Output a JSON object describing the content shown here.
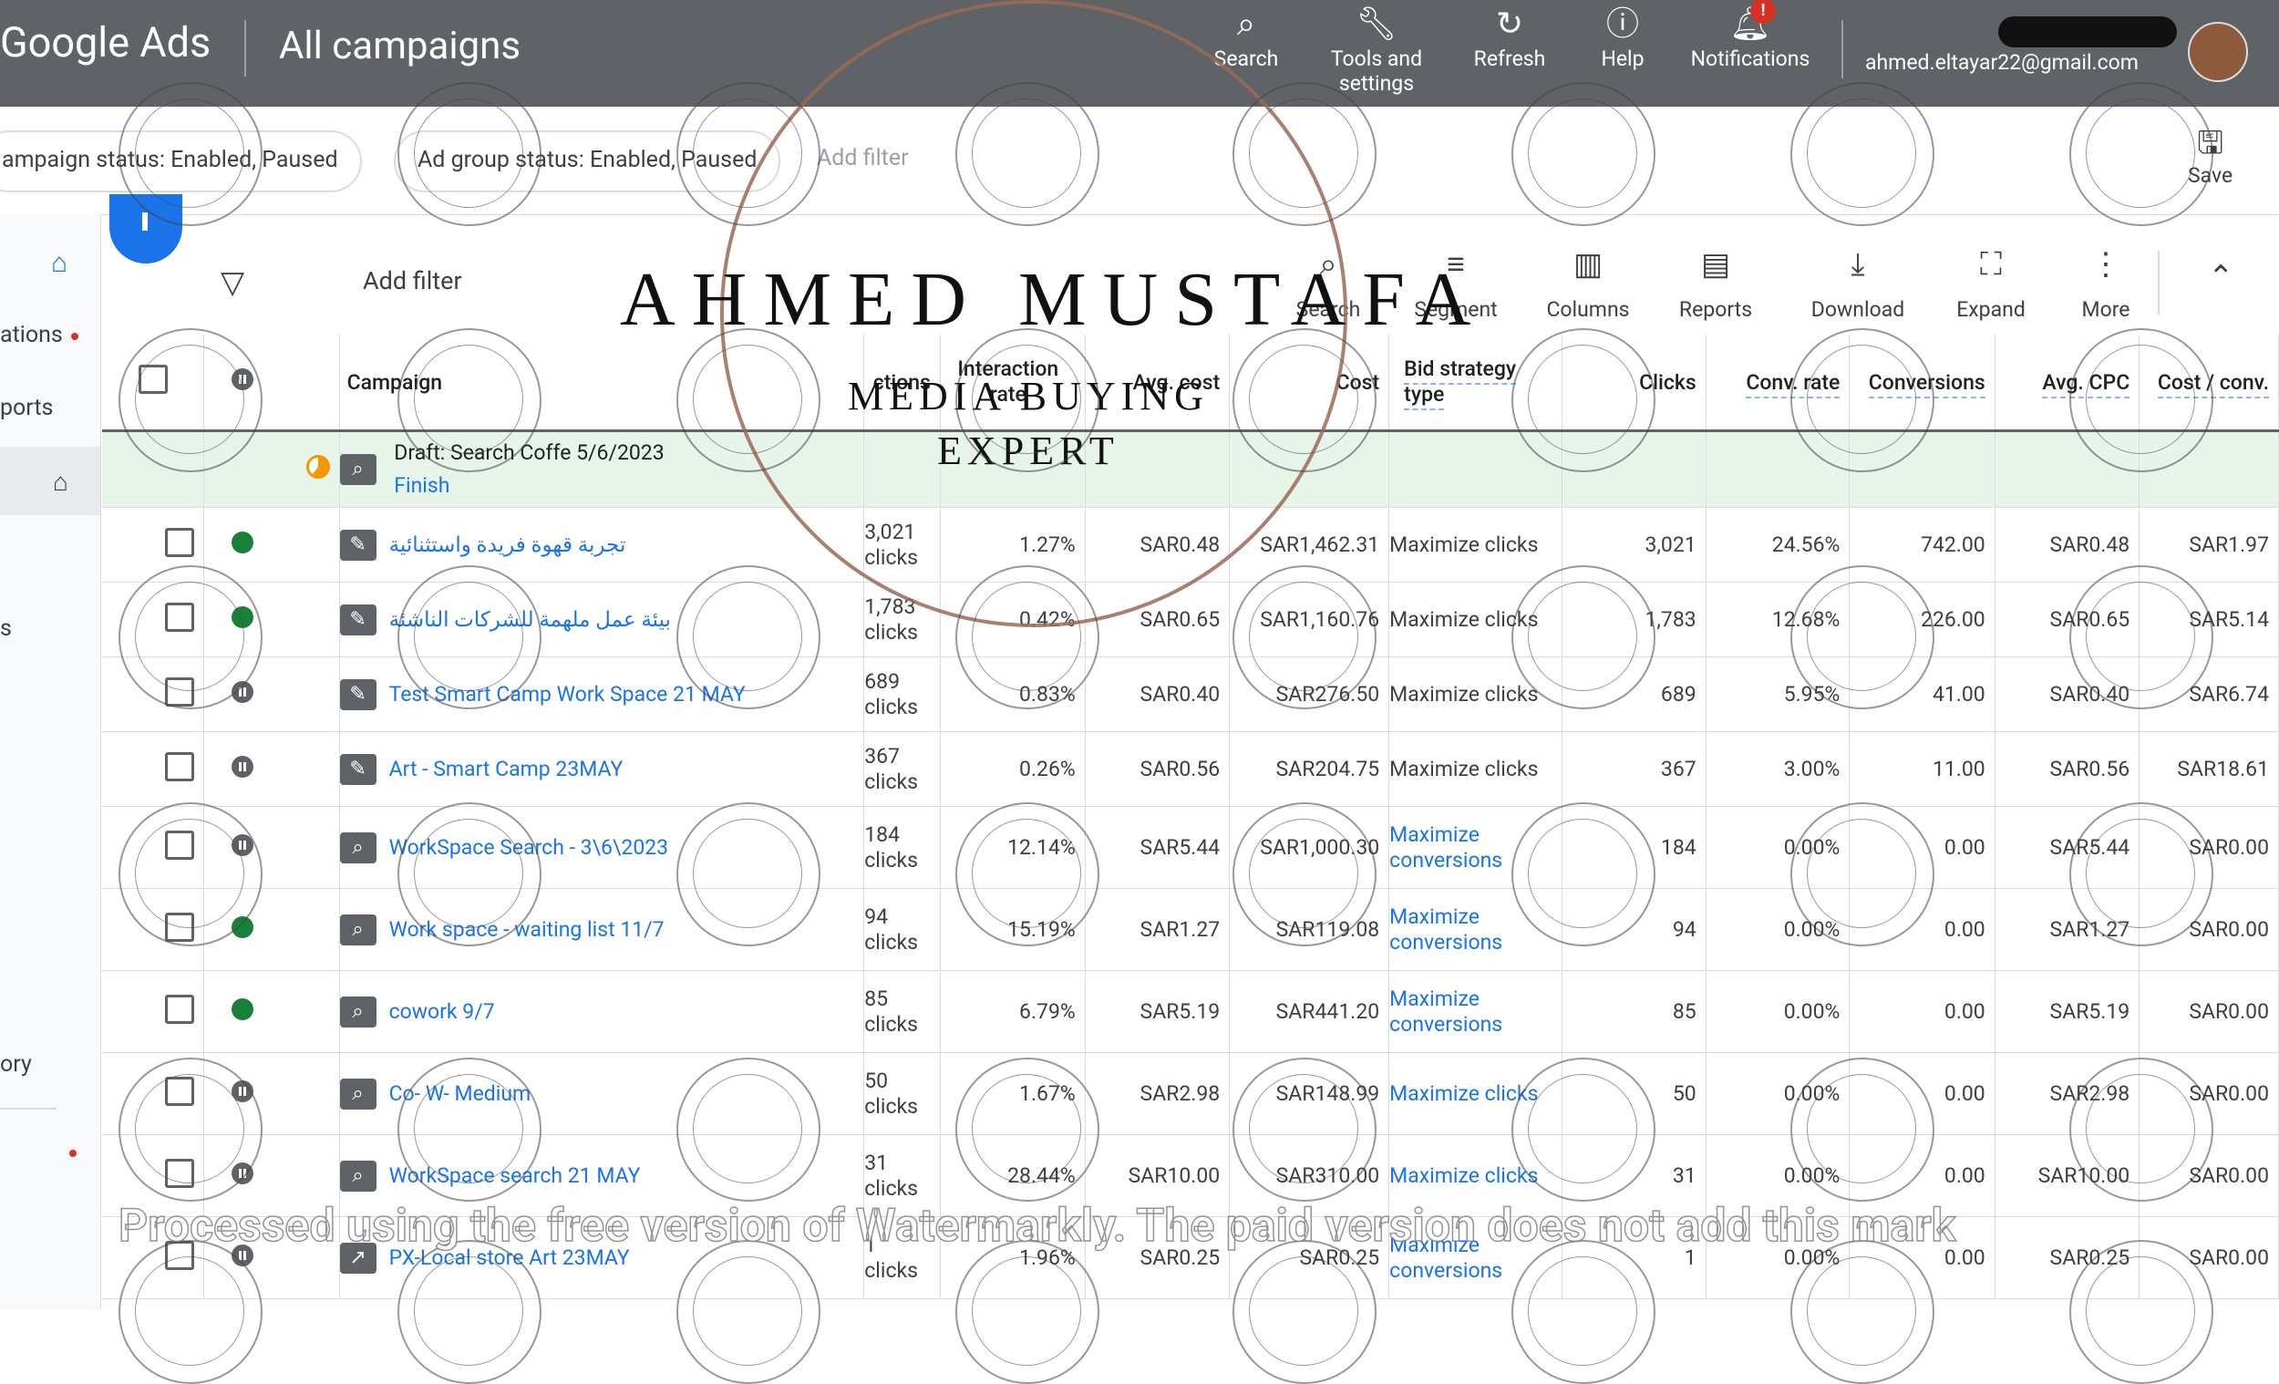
{
  "header": {
    "brand": "Google Ads",
    "title": "All campaigns",
    "tools": [
      {
        "label": "Search",
        "icon": "search-icon"
      },
      {
        "label": "Tools and settings",
        "icon": "wrench-icon"
      },
      {
        "label": "Refresh",
        "icon": "refresh-icon"
      },
      {
        "label": "Help",
        "icon": "help-icon"
      },
      {
        "label": "Notifications",
        "icon": "bell-icon",
        "badge": "!"
      }
    ],
    "email": "ahmed.eltayar22@gmail.com"
  },
  "filters": {
    "chips": [
      "ampaign status: Enabled, Paused",
      "Ad group status: Enabled, Paused"
    ],
    "add_filter": "Add filter",
    "save": "Save"
  },
  "nav": {
    "items": [
      "ations",
      "ports",
      "s",
      "ory"
    ]
  },
  "toolbar": {
    "add_filter": "Add filter",
    "tools": [
      "Search",
      "Segment",
      "Columns",
      "Reports",
      "Download",
      "Expand",
      "More"
    ]
  },
  "table": {
    "headers": {
      "campaign": "Campaign",
      "interactions": "ctions",
      "interaction_rate": "Interaction rate",
      "avg_cost": "Avg. cost",
      "cost": "Cost",
      "bid_strategy": "Bid strategy type",
      "clicks": "Clicks",
      "conv_rate": "Conv. rate",
      "conversions": "Conversions",
      "avg_cpc": "Avg. CPC",
      "cost_conv": "Cost / conv."
    },
    "draft": {
      "name": "Draft: Search Coffe 5/6/2023",
      "action": "Finish"
    },
    "rows": [
      {
        "status": "on",
        "type": "smart",
        "name": "تجربة قهوة فريدة واستثنائية",
        "interactions": "3,021",
        "unit": "clicks",
        "rate": "1.27%",
        "avg_cost": "SAR0.48",
        "cost": "SAR1,462.31",
        "bid": "Maximize clicks",
        "bid_link": false,
        "clicks": "3,021",
        "conv_rate": "24.56%",
        "conversions": "742.00",
        "avg_cpc": "SAR0.48",
        "cost_conv": "SAR1.97"
      },
      {
        "status": "on",
        "type": "smart",
        "name": "بيئة عمل ملهمة للشركات الناشئة",
        "interactions": "1,783",
        "unit": "clicks",
        "rate": "0.42%",
        "avg_cost": "SAR0.65",
        "cost": "SAR1,160.76",
        "bid": "Maximize clicks",
        "bid_link": false,
        "clicks": "1,783",
        "conv_rate": "12.68%",
        "conversions": "226.00",
        "avg_cpc": "SAR0.65",
        "cost_conv": "SAR5.14"
      },
      {
        "status": "pause",
        "type": "smart",
        "name": "Test Smart Camp Work Space 21 MAY",
        "interactions": "689",
        "unit": "clicks",
        "rate": "0.83%",
        "avg_cost": "SAR0.40",
        "cost": "SAR276.50",
        "bid": "Maximize clicks",
        "bid_link": false,
        "clicks": "689",
        "conv_rate": "5.95%",
        "conversions": "41.00",
        "avg_cpc": "SAR0.40",
        "cost_conv": "SAR6.74"
      },
      {
        "status": "pause",
        "type": "smart",
        "name": "Art - Smart Camp 23MAY",
        "interactions": "367",
        "unit": "clicks",
        "rate": "0.26%",
        "avg_cost": "SAR0.56",
        "cost": "SAR204.75",
        "bid": "Maximize clicks",
        "bid_link": false,
        "clicks": "367",
        "conv_rate": "3.00%",
        "conversions": "11.00",
        "avg_cpc": "SAR0.56",
        "cost_conv": "SAR18.61"
      },
      {
        "status": "pause",
        "type": "search",
        "name": "WorkSpace Search - 3\\6\\2023",
        "interactions": "184",
        "unit": "clicks",
        "rate": "12.14%",
        "avg_cost": "SAR5.44",
        "cost": "SAR1,000.30",
        "bid": "Maximize conversions",
        "bid_link": true,
        "clicks": "184",
        "conv_rate": "0.00%",
        "conversions": "0.00",
        "avg_cpc": "SAR5.44",
        "cost_conv": "SAR0.00"
      },
      {
        "status": "on",
        "type": "search",
        "name": "Work space - waiting list 11/7",
        "interactions": "94",
        "unit": "clicks",
        "rate": "15.19%",
        "avg_cost": "SAR1.27",
        "cost": "SAR119.08",
        "bid": "Maximize conversions",
        "bid_link": true,
        "clicks": "94",
        "conv_rate": "0.00%",
        "conversions": "0.00",
        "avg_cpc": "SAR1.27",
        "cost_conv": "SAR0.00"
      },
      {
        "status": "on",
        "type": "search",
        "name": "cowork 9/7",
        "interactions": "85",
        "unit": "clicks",
        "rate": "6.79%",
        "avg_cost": "SAR5.19",
        "cost": "SAR441.20",
        "bid": "Maximize conversions",
        "bid_link": true,
        "clicks": "85",
        "conv_rate": "0.00%",
        "conversions": "0.00",
        "avg_cpc": "SAR5.19",
        "cost_conv": "SAR0.00"
      },
      {
        "status": "pause",
        "type": "search",
        "name": "Co- W- Medium",
        "interactions": "50",
        "unit": "clicks",
        "rate": "1.67%",
        "avg_cost": "SAR2.98",
        "cost": "SAR148.99",
        "bid": "Maximize clicks",
        "bid_link": true,
        "clicks": "50",
        "conv_rate": "0.00%",
        "conversions": "0.00",
        "avg_cpc": "SAR2.98",
        "cost_conv": "SAR0.00"
      },
      {
        "status": "pause",
        "type": "search",
        "name": "WorkSpace search 21 MAY",
        "interactions": "31",
        "unit": "clicks",
        "rate": "28.44%",
        "avg_cost": "SAR10.00",
        "cost": "SAR310.00",
        "bid": "Maximize clicks",
        "bid_link": true,
        "clicks": "31",
        "conv_rate": "0.00%",
        "conversions": "0.00",
        "avg_cpc": "SAR10.00",
        "cost_conv": "SAR0.00"
      },
      {
        "status": "pause",
        "type": "pmax",
        "name": "PX-Local store Art 23MAY",
        "interactions": "1",
        "unit": "clicks",
        "rate": "1.96%",
        "avg_cost": "SAR0.25",
        "cost": "SAR0.25",
        "bid": "Maximize conversions",
        "bid_link": true,
        "clicks": "1",
        "conv_rate": "0.00%",
        "conversions": "0.00",
        "avg_cpc": "SAR0.25",
        "cost_conv": "SAR0.00"
      }
    ]
  },
  "watermark": {
    "title": "AHMED MUSTAFA",
    "subtitle_1": "MEDIA BUYING",
    "subtitle_2": "EXPERT",
    "banner": "Processed using the free version of Watermarkly. The paid version does not add this mark"
  }
}
